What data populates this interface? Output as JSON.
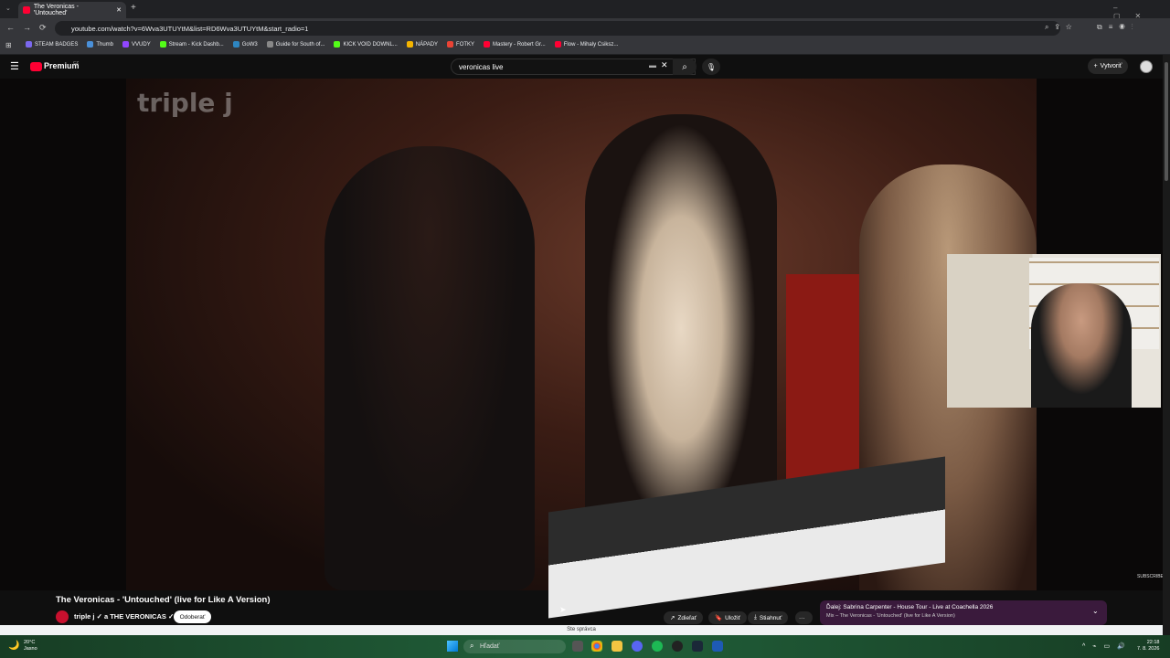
{
  "browser": {
    "tab_title": "The Veronicas - 'Untouched'",
    "url": "youtube.com/watch?v=6Wva3UTUYtM&list=RD6Wva3UTUYtM&start_radio=1",
    "bookmarks": [
      {
        "label": "STEAM BADGES",
        "color": "#7b68ee"
      },
      {
        "label": "Thumb",
        "color": "#4a90d9"
      },
      {
        "label": "VVUDY",
        "color": "#9146ff"
      },
      {
        "label": "Stream - Kick Dashb...",
        "color": "#53fc18"
      },
      {
        "label": "GoW3",
        "color": "#2e86c1"
      },
      {
        "label": "Guide for South of...",
        "color": "#888888"
      },
      {
        "label": "KICK VOID DOWNL...",
        "color": "#53fc18"
      },
      {
        "label": "NÁPADY",
        "color": "#f4b400"
      },
      {
        "label": "FOTKY",
        "color": "#ea4335"
      },
      {
        "label": "Mastery - Robert Gr...",
        "color": "#ff0033"
      },
      {
        "label": "Flow - Mihaly Csiksz...",
        "color": "#ff0033"
      }
    ],
    "status_text": "Ste správca"
  },
  "youtube": {
    "logo_text": "Premium",
    "logo_badge": "CZ",
    "search_value": "veronicas live",
    "create_label": "Vytvoriť",
    "video_overlay_logo": "triple j",
    "subscribe_watermark": "SUBSCRIBE",
    "video_title": "The Veronicas - 'Untouched' (live for Like A Version)",
    "channel_line": "triple j ✓ a THE VERONICAS ✓",
    "unsubscribe_label": "Odoberať",
    "share_label": "Zdieľať",
    "save_label": "Uložiť",
    "download_label": "Stiahnuť",
    "more_label": "···",
    "next_title": "Ďalej: Sabrina Carpenter - House Tour - Live at Coachella 2026",
    "next_subtitle": "Mix – The Veronicas - 'Untouched' (live for Like A Version)"
  },
  "taskbar": {
    "weather_temp": "20°C",
    "weather_desc": "Jasno",
    "search_placeholder": "Hľadať",
    "time": "22:18",
    "date": "7. 8. 2026"
  },
  "colors": {
    "accent": "#ff0033",
    "brand": "#0f0f0f",
    "next_box": "#3a1a3c"
  }
}
